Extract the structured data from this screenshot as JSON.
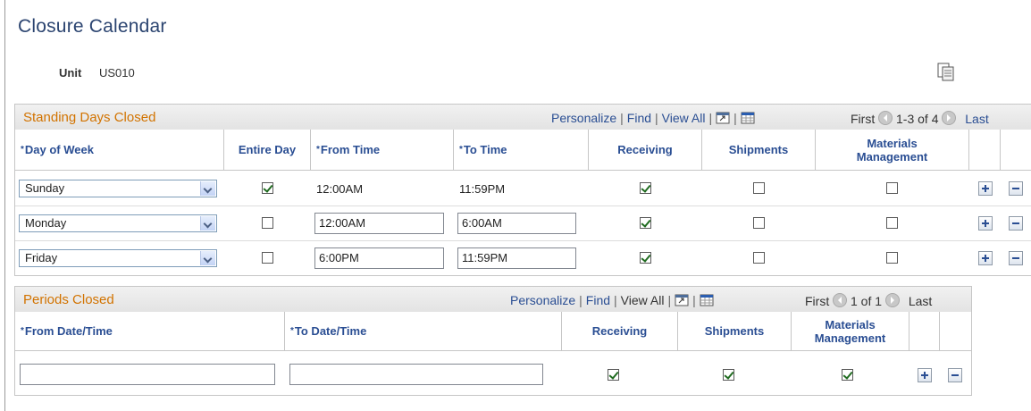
{
  "page": {
    "title": "Closure Calendar"
  },
  "unit": {
    "label": "Unit",
    "value": "US010"
  },
  "icons": {
    "copy": "copy-document-icon",
    "zoom": "view-grid-icon",
    "download": "download-spreadsheet-icon",
    "prev": "previous-arrow-icon",
    "next": "next-arrow-icon",
    "add": "add-row-icon",
    "delete": "delete-row-icon",
    "dropdown": "chevron-down-icon"
  },
  "colors": {
    "title": "#2b4470",
    "grid_title": "#d27300",
    "link": "#2a4e93",
    "check": "#1f6b1f"
  },
  "standing_days": {
    "title": "Standing Days Closed",
    "nav": {
      "personalize": "Personalize",
      "find": "Find",
      "view_all": "View All",
      "first": "First",
      "range": "1-3 of 4",
      "last": "Last"
    },
    "columns": {
      "day_of_week": "Day of Week",
      "entire_day": "Entire Day",
      "from_time": "From Time",
      "to_time": "To Time",
      "receiving": "Receiving",
      "shipments": "Shipments",
      "materials": "Materials Management"
    },
    "rows": [
      {
        "day": "Sunday",
        "entire_day": true,
        "from_time": "12:00AM",
        "to_time": "11:59PM",
        "receiving": true,
        "shipments": false,
        "materials": false
      },
      {
        "day": "Monday",
        "entire_day": false,
        "from_time": "12:00AM",
        "to_time": "6:00AM",
        "receiving": true,
        "shipments": false,
        "materials": false
      },
      {
        "day": "Friday",
        "entire_day": false,
        "from_time": "6:00PM",
        "to_time": "11:59PM",
        "receiving": true,
        "shipments": false,
        "materials": false
      }
    ]
  },
  "periods_closed": {
    "title": "Periods Closed",
    "nav": {
      "personalize": "Personalize",
      "find": "Find",
      "view_all": "View All",
      "first": "First",
      "range": "1 of 1",
      "last": "Last"
    },
    "columns": {
      "from_datetime": "From Date/Time",
      "to_datetime": "To Date/Time",
      "receiving": "Receiving",
      "shipments": "Shipments",
      "materials": "Materials Management"
    },
    "rows": [
      {
        "from_datetime": "",
        "to_datetime": "",
        "receiving": true,
        "shipments": true,
        "materials": true
      }
    ]
  }
}
